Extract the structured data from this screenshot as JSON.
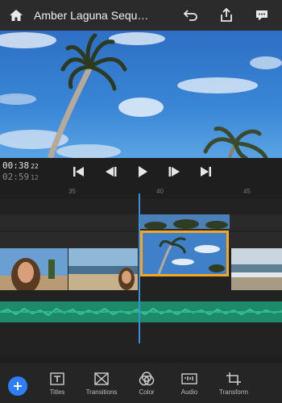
{
  "header": {
    "title": "Amber Laguna Sequ…",
    "icons": [
      "home-icon",
      "undo-icon",
      "share-icon",
      "comment-icon"
    ]
  },
  "transport": {
    "current_time": "00:38",
    "current_frame": "22",
    "total_time": "02:59",
    "total_frame": "12",
    "controls": [
      "skip-to-start-icon",
      "step-back-icon",
      "play-icon",
      "step-forward-icon",
      "skip-to-end-icon"
    ]
  },
  "ruler": {
    "ticks": [
      "35",
      "40",
      "45"
    ]
  },
  "timeline": {
    "video_clips": [
      "selfie-clip",
      "beach-clip",
      "palm-tree-clip",
      "ocean-clip"
    ],
    "overlay_clip": "palm-tree-overlay",
    "audio_track": "audio-waveform",
    "colors": {
      "selection": "#f5a623",
      "audio": "#1d8a6a",
      "playhead": "#3b8ed8"
    }
  },
  "toolbar": {
    "add_icon": "plus-icon",
    "items": [
      {
        "label": "Titles",
        "icon": "titles-icon"
      },
      {
        "label": "Transitions",
        "icon": "transitions-icon"
      },
      {
        "label": "Color",
        "icon": "color-icon"
      },
      {
        "label": "Audio",
        "icon": "audio-icon"
      },
      {
        "label": "Transform",
        "icon": "transform-icon"
      }
    ],
    "accent": "#2d7ff9"
  }
}
